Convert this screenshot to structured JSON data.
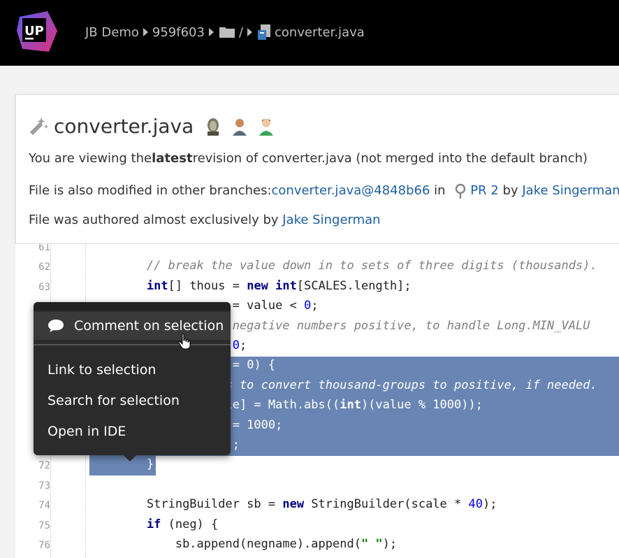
{
  "topbar": {
    "logo_text": "UP",
    "breadcrumb": {
      "project": "JB Demo",
      "revision": "959f603",
      "path_sep": "/",
      "file": "converter.java"
    },
    "colors": {
      "background": "#000000",
      "logo_gradient": [
        "#5b5cf0",
        "#e0307a"
      ]
    }
  },
  "card": {
    "title": "converter.java",
    "line1": {
      "pre": "You are viewing the ",
      "bold": "latest",
      "post": " revision of converter.java (not merged into the default branch)"
    },
    "line2": {
      "pre": "File is also modified in other branches: ",
      "link": "converter.java@4848b66",
      "mid": " in ",
      "pr": "PR 2",
      "by": " by ",
      "author": "Jake Singerman"
    },
    "line3": {
      "pre": "File was authored almost exclusively by ",
      "author": "Jake Singerman"
    },
    "avatars": [
      "avatar-1",
      "avatar-2",
      "avatar-3"
    ]
  },
  "code": {
    "lines": [
      {
        "n": "61",
        "parts": []
      },
      {
        "n": "62",
        "parts": [
          [
            "cm",
            "// break the value down in to sets of three digits (thousands)."
          ]
        ]
      },
      {
        "n": "63",
        "parts": [
          [
            "kw",
            "int"
          ],
          [
            "t",
            "[] thous = "
          ],
          [
            "kw",
            "new"
          ],
          [
            "t",
            " "
          ],
          [
            "kw",
            "int"
          ],
          [
            "t",
            "[SCALES.length];"
          ]
        ]
      },
      {
        "n": "64",
        "parts": [
          [
            "t",
            "            = value < "
          ],
          [
            "num",
            "0"
          ],
          [
            "t",
            ";"
          ]
        ]
      },
      {
        "n": "65",
        "parts": [
          [
            "cm",
            "        ake negative numbers positive, to handle Long.MIN_VALU"
          ]
        ]
      },
      {
        "n": "66",
        "parts": [
          [
            "t",
            "            "
          ],
          [
            "num",
            "0"
          ],
          [
            "t",
            ";"
          ]
        ]
      },
      {
        "n": "67",
        "parts": [
          [
            "t",
            "         e != "
          ],
          [
            "num",
            "0"
          ],
          [
            "t",
            ") {"
          ]
        ]
      },
      {
        "n": "68",
        "parts": [
          [
            "cm",
            "         abs to convert thousand-groups to positive, if needed."
          ]
        ]
      },
      {
        "n": "69",
        "parts": [
          [
            "t",
            "         cale] = Math.abs(("
          ],
          [
            "kw",
            "int"
          ],
          [
            "t",
            ")(value % 1000));"
          ]
        ]
      },
      {
        "n": "70",
        "parts": [
          [
            "t",
            "            = 1000;"
          ]
        ]
      },
      {
        "n": "71",
        "parts": [
          [
            "t",
            "            ;"
          ]
        ]
      },
      {
        "n": "72",
        "parts": [
          [
            "t",
            "}"
          ]
        ]
      },
      {
        "n": "73",
        "parts": []
      },
      {
        "n": "74",
        "parts": [
          [
            "t",
            "StringBuilder sb = "
          ],
          [
            "kw",
            "new"
          ],
          [
            "t",
            " StringBuilder(scale * "
          ],
          [
            "num",
            "40"
          ],
          [
            "t",
            ");"
          ]
        ]
      },
      {
        "n": "75",
        "parts": [
          [
            "kw",
            "if"
          ],
          [
            "t",
            " (neg) {"
          ]
        ]
      },
      {
        "n": "76",
        "parts": [
          [
            "t",
            "    sb.append(negname).append("
          ],
          [
            "str",
            "\" \""
          ],
          [
            "t",
            ");"
          ]
        ]
      }
    ],
    "colors": {
      "selection": "#6985b3",
      "keyword": "#000080",
      "comment": "#808080",
      "number": "#0000ff",
      "string": "#008000"
    }
  },
  "popup": {
    "items": {
      "comment": "Comment on selection",
      "link": "Link to selection",
      "search": "Search for selection",
      "ide": "Open in IDE"
    }
  }
}
